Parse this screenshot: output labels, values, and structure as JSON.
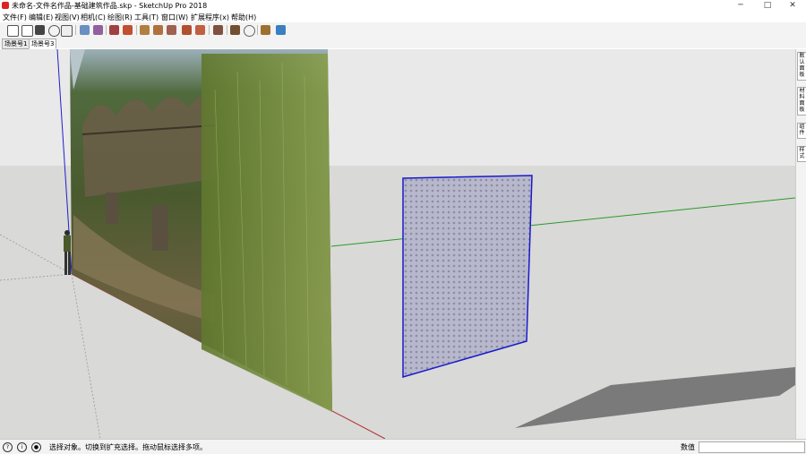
{
  "window": {
    "title": "未命名-文件名作品-基础建筑作品.skp - SketchUp Pro 2018",
    "minimize": "─",
    "maximize": "□",
    "close": "✕"
  },
  "menu": [
    {
      "label": "文件(F)"
    },
    {
      "label": "编辑(E)"
    },
    {
      "label": "视图(V)"
    },
    {
      "label": "相机(C)"
    },
    {
      "label": "绘图(R)"
    },
    {
      "label": "工具(T)"
    },
    {
      "label": "窗口(W)"
    },
    {
      "label": "扩展程序(x)"
    },
    {
      "label": "帮助(H)"
    }
  ],
  "toolbar_icons": [
    "new-icon",
    "open-icon",
    "save-icon",
    "undo-icon",
    "print-icon",
    "model-info-icon",
    "upload-icon",
    "select-icon",
    "paint-icon",
    "eraser-icon",
    "pencil-icon",
    "line-icon",
    "pushpull-icon",
    "move-icon",
    "section-icon",
    "component-icon",
    "rotate-icon",
    "orbit-icon",
    "pan-icon",
    "extension-icon"
  ],
  "scene_tabs": [
    {
      "label": "场景号1",
      "active": false
    },
    {
      "label": "场景号3",
      "active": true
    }
  ],
  "right_panel": [
    {
      "label": "默认面板"
    },
    {
      "label": "材料面板"
    },
    {
      "label": "组件"
    },
    {
      "label": "样式"
    }
  ],
  "status": {
    "text": "选择对象。切换到扩充选择。拖动鼠标选择多项。",
    "measure_label": "数值",
    "measure_value": ""
  },
  "colors": {
    "sky": "#e9e9e9",
    "ground": "#d9d9d7",
    "selection_edge": "#1a1acc",
    "axis_red": "#b03030",
    "axis_green": "#2a9a2a",
    "axis_blue": "#2020c8"
  }
}
